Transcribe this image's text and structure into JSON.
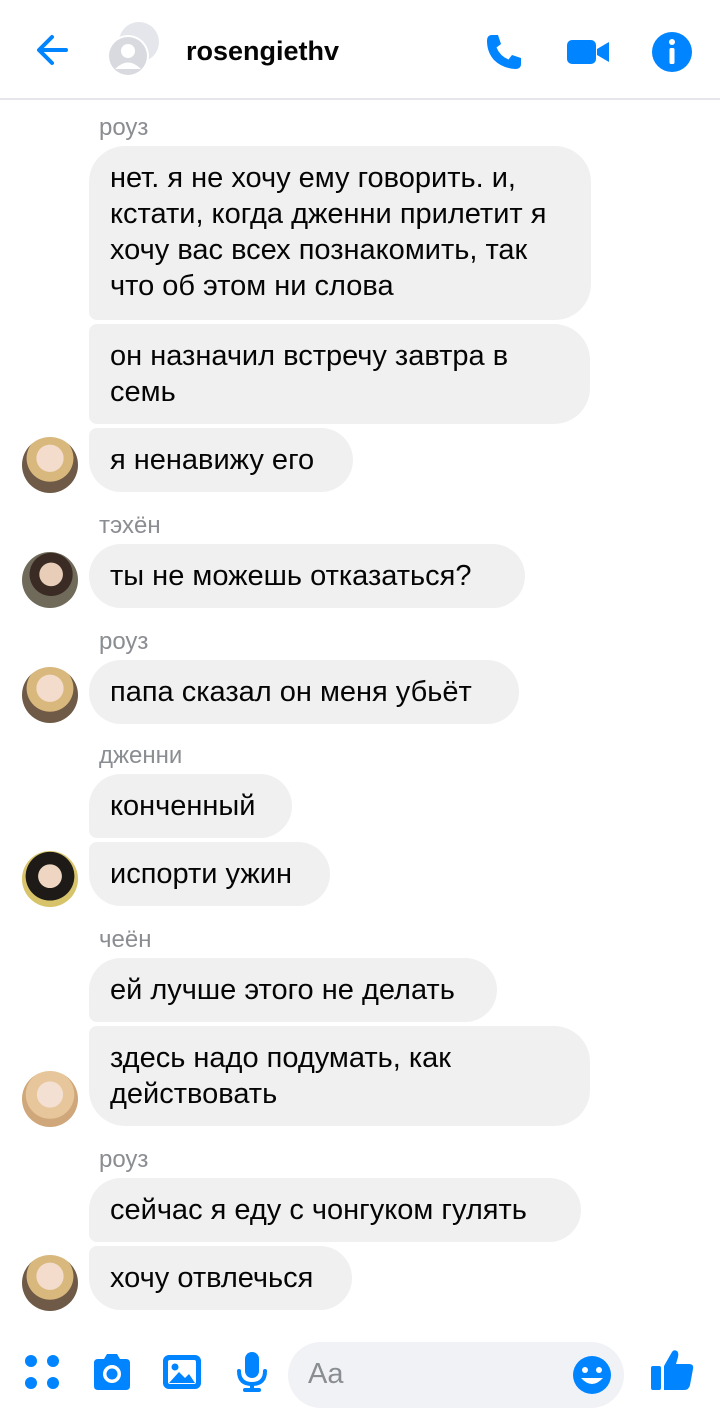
{
  "header": {
    "title": "rosengiethv"
  },
  "colors": {
    "accent": "#0084ff",
    "bubble": "#f0f0f0",
    "sender_label": "#8a8d91"
  },
  "icons": {
    "back": "arrow-left-icon",
    "call": "phone-icon",
    "video": "video-camera-icon",
    "info": "info-icon",
    "menu": "dots-grid-icon",
    "camera": "camera-icon",
    "gallery": "image-icon",
    "voice": "microphone-icon",
    "emoji": "smiley-icon",
    "like": "thumbs-up-icon"
  },
  "messages": {
    "sender_1": "роуз",
    "m1": "нет. я не хочу ему говорить. и, кстати, когда дженни прилетит я хочу вас всех познакомить, так что об этом ни слова",
    "m2": "он назначил встречу завтра в семь",
    "m3": "я ненавижу его",
    "sender_2": "тэхён",
    "m4": "ты не можешь отказаться?",
    "sender_3": "роуз",
    "m5": "папа сказал он меня убьёт",
    "sender_4": "дженни",
    "m6": "конченный",
    "m7": "испорти ужин",
    "sender_5": "чеён",
    "m8": "ей лучше этого не делать",
    "m9": "здесь надо подумать, как действовать",
    "sender_6": "роуз",
    "m10": "сейчас я еду с чонгуком гулять",
    "m11": "хочу отвлечься"
  },
  "composer": {
    "placeholder": "Aa"
  }
}
